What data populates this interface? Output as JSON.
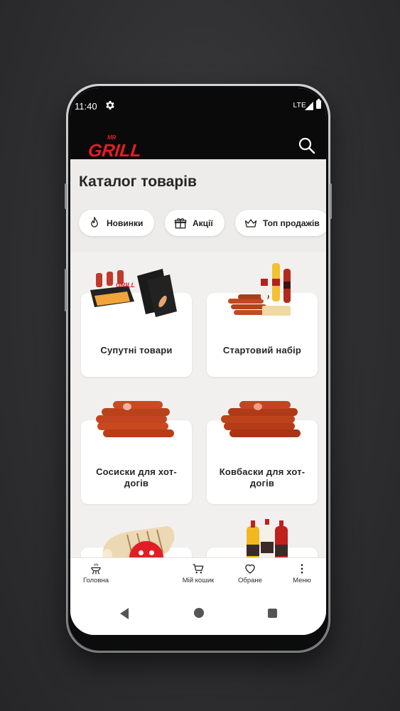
{
  "status_bar": {
    "time": "11:40",
    "network": "LTE"
  },
  "header": {
    "logo_text": "MR GRILL",
    "logo_color": "#e21e24"
  },
  "catalog": {
    "title": "Каталог товарів",
    "chips": [
      {
        "label": "Новинки",
        "icon": "fire-icon"
      },
      {
        "label": "Акції",
        "icon": "gift-icon"
      },
      {
        "label": "Топ продажів",
        "icon": "crown-icon"
      }
    ],
    "categories": [
      {
        "label": "Супутні товари"
      },
      {
        "label": "Стартовий набір"
      },
      {
        "label": "Сосиски для хот-догів"
      },
      {
        "label": "Ковбаски для хот-догів"
      },
      {
        "label": ""
      },
      {
        "label": ""
      }
    ]
  },
  "bottom_nav": {
    "items": [
      {
        "label": "Головна",
        "icon": "grill-icon"
      },
      {
        "label": "Мій кошик",
        "icon": "cart-icon"
      },
      {
        "label": "Обране",
        "icon": "heart-icon"
      },
      {
        "label": "Меню",
        "icon": "more-vertical-icon"
      }
    ],
    "fab_icon": "four-dots-icon",
    "fab_color": "#e21e24"
  }
}
